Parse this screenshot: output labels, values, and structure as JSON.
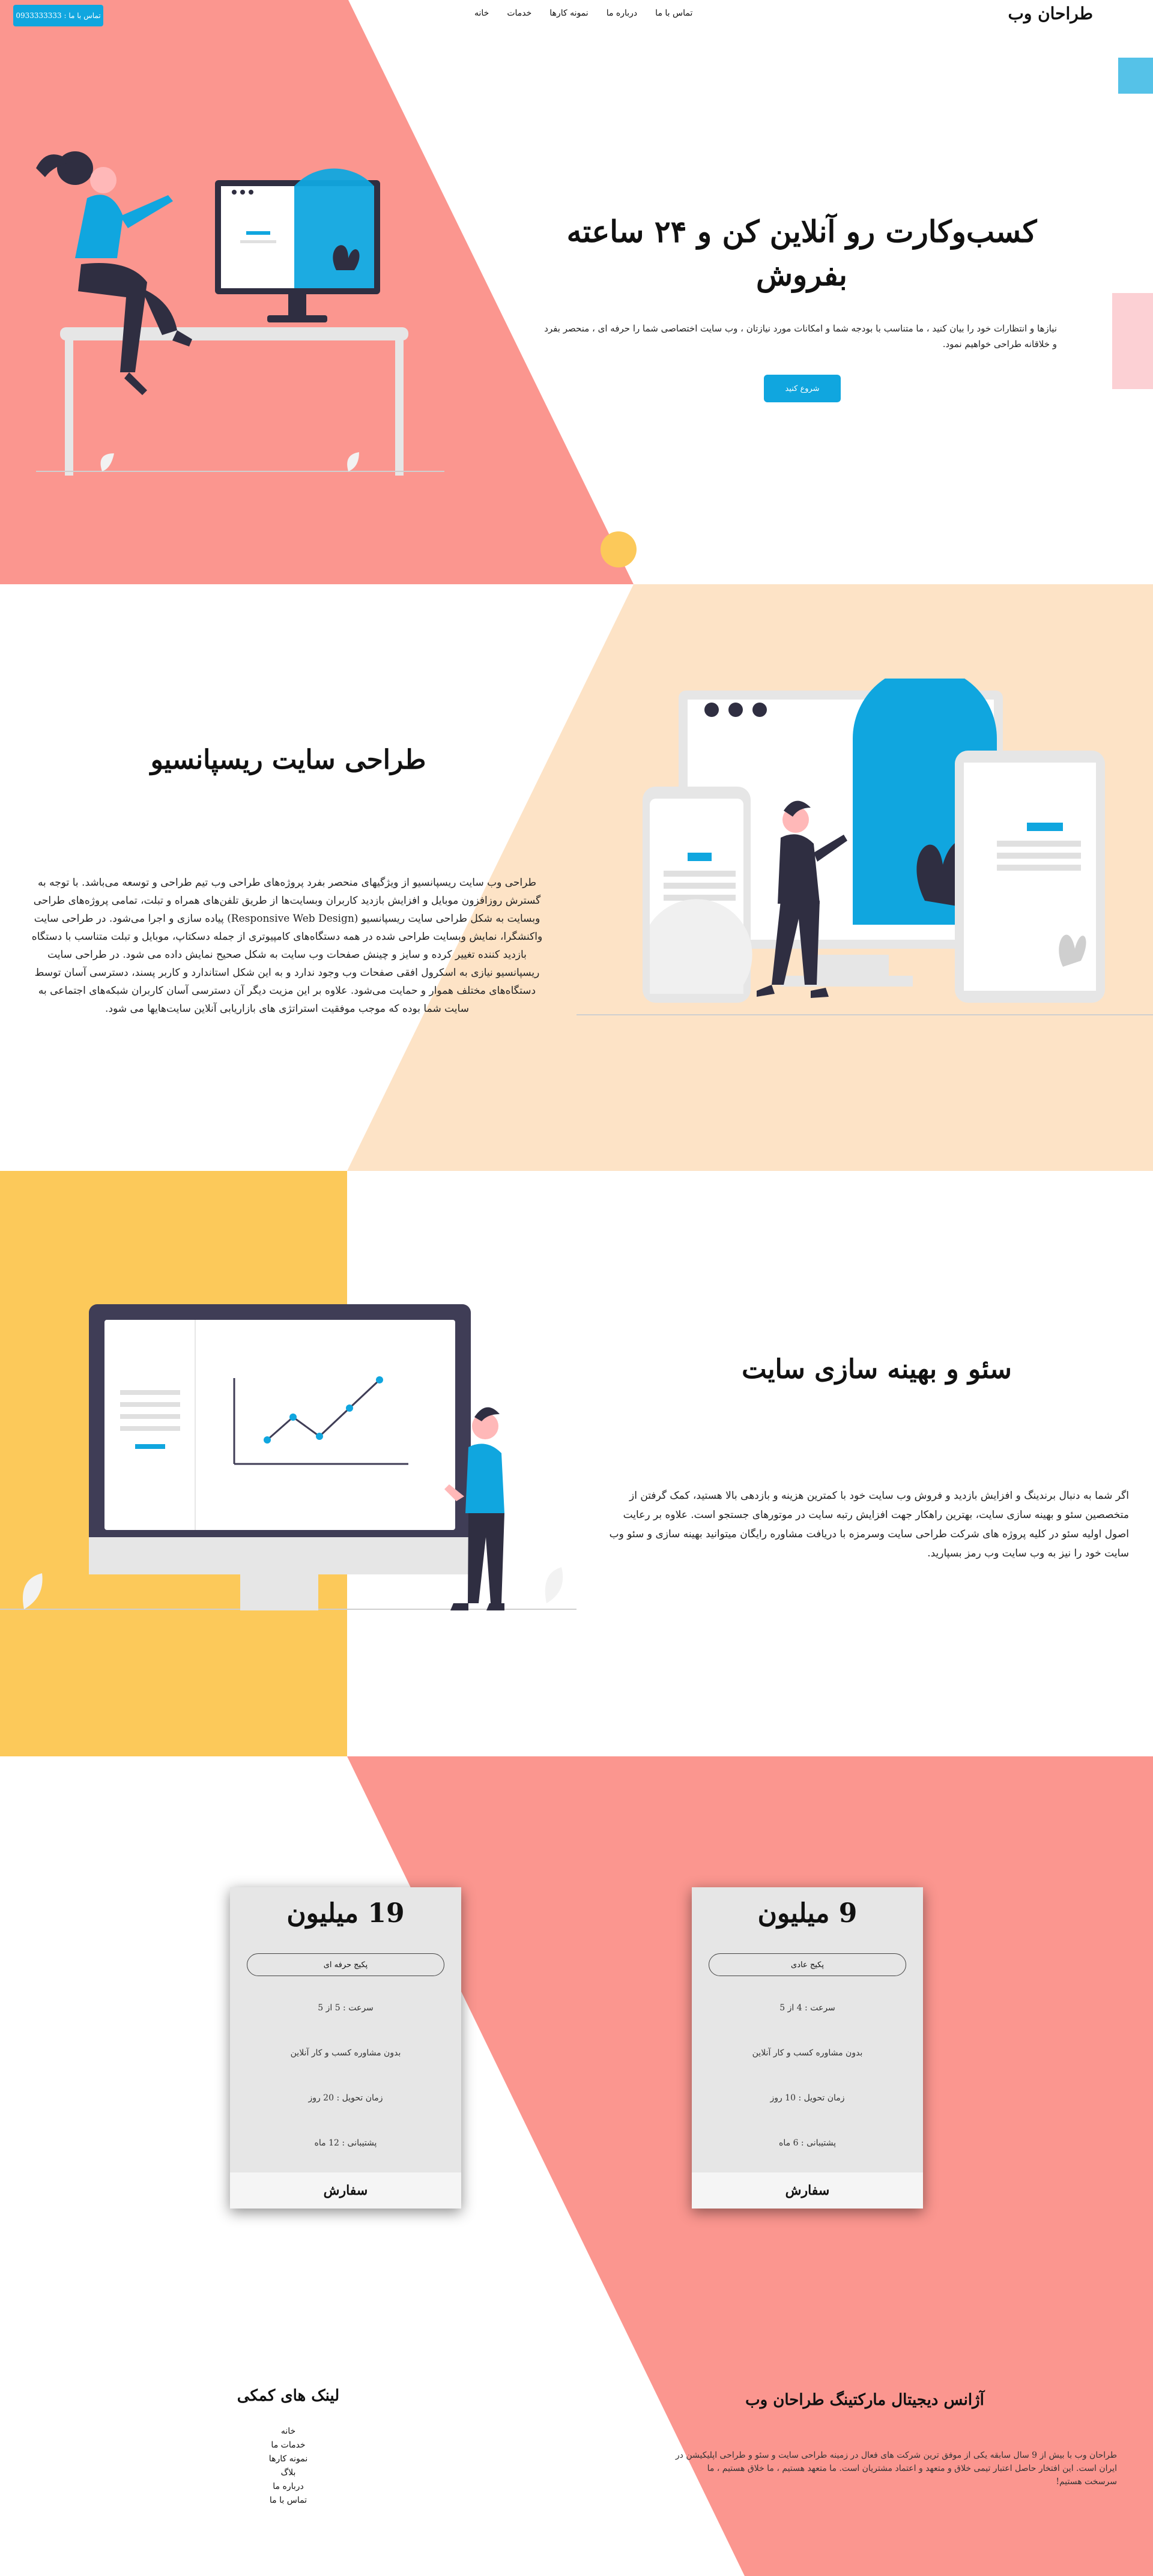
{
  "header": {
    "brand": "طراحان وب",
    "nav": [
      "خانه",
      "خدمات",
      "نمونه کارها",
      "درباره ما",
      "تماس با ما"
    ],
    "contact_button": "تماس با ما : 0933333333"
  },
  "hero": {
    "title_line1": "کسب‌وکارت رو آنلاین کن و ۲۴ ساعته",
    "title_line2": "بفروش",
    "description": "نیازها و انتظارات خود را بیان کنید ، ما متناسب با بودجه شما و امکانات مورد نیازتان ، وب سایت اختصاصی شما را حرفه ای ، منحصر بفرد و خلاقانه طراحی خواهیم نمود.",
    "cta": "شروع کنید"
  },
  "responsive": {
    "title": "طراحی سایت ریسپانسیو",
    "description": "طراحی وب سایت ریسپانسیو از ویژگیهای منحصر بفرد پروژه‌های طراحی وب تیم طراحی و توسعه می‌باشد. با توجه به گسترش روزافزون موبایل و افزایش بازدید کاربران وبسایت‌ها از طریق تلفن‌های همراه و تبلت، تمامی پروژه‌های طراحی وبسایت به شکل طراحی سایت ریسپانسیو (Responsive Web Design) پیاده سازی و اجرا می‌شود. در طراحی سایت واکنشگرا، نمایش وبسایت طراحی شده در همه دستگاه‌های کامپیوتری از جمله دسکتاپ، موبایل و تبلت متناسب با دستگاه بازدید کننده تغییر کرده و سایز و چینش صفحات وب سایت به شکل صحیح نمایش داده می شود. در طراحی سایت ریسپانسیو نیازی به اسکرول افقی صفحات وب وجود ندارد و به این شکل استاندارد و کاربر پسند، دسترسی آسان توسط دستگاه‌های مختلف هموار و حمایت می‌شود. علاوه بر این مزیت دیگر آن دسترسی آسان کاربران شبکه‌های اجتماعی به سایت شما بوده که موجب موفقیت استراتژی های بازاریابی آنلاین سایت‌هایها می شود."
  },
  "seo": {
    "title": "سئو و بهینه سازی سایت",
    "description": "اگر شما به دنبال برندینگ و افزایش بازدید و فروش وب سایت خود با کمترین هزینه و بازدهی بالا هستید، کمک گرفتن از متخصصین سئو و بهینه سازی سایت، بهترین راهکار جهت افزایش رتبه سایت در موتورهای جستجو است. علاوه بر رعایت اصول اولیه سئو در کلیه پروژه های شرکت طراحی سایت وسرمزه با دریافت مشاوره رایگان میتوانید بهینه سازی و سئو وب سایت خود را نیز به وب سایت وب رمز بسپارید."
  },
  "pricing": {
    "order_label": "سفارش",
    "plans": [
      {
        "price": "9 میلیون",
        "name": "پکیج عادی",
        "features": [
          "سرعت : 4 از 5",
          "بدون مشاوره کسب و کار آنلاین",
          "زمان تحویل : 10 روز",
          "پشتیبانی : 6 ماه"
        ]
      },
      {
        "price": "19 میلیون",
        "name": "پکیج حرفه ای",
        "features": [
          "سرعت : 5 از 5",
          "بدون مشاوره کسب و کار آنلاین",
          "زمان تحویل : 20 روز",
          "پشتیبانی : 12 ماه"
        ]
      }
    ]
  },
  "footer": {
    "agency_title": "آژانس دیجیتال مارکتینگ طراحان وب",
    "agency_description": "طراحان وب با بیش از 9 سال سابقه یکی از موفق ترین شرکت های فعال در زمینه طراحی سایت و سئو و طراحی اپلیکیشن در ایران است. این افتخار حاصل اعتبار تیمی خلاق و متعهد و اعتماد مشتریان است. ما متعهد هستیم ، ما خلاق هستیم ، ما سرسخت هستیم!",
    "links_title": "لینک های کمکی",
    "links": [
      "خانه",
      "خدمات ما",
      "نمونه کارها",
      "بلاگ",
      "درباره ما",
      "تماس با ما"
    ]
  },
  "colors": {
    "accent": "#10a6df",
    "salmon": "#fb968f",
    "peach": "#fde3c6",
    "yellow": "#fcc95a",
    "dark": "#2f2e41"
  }
}
